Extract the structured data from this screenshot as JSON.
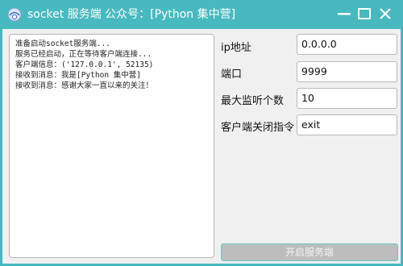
{
  "window": {
    "title": "socket 服务端   公众号：[Python 集中营]",
    "accent_color": "#48b9bf",
    "controls": [
      "minimize-icon",
      "maximize-icon",
      "close-icon"
    ]
  },
  "log": {
    "lines": [
      "准备启动socket服务端...",
      "服务已经启动，正在等待客户端连接...",
      "客户端信息：('127.0.0.1', 52135)",
      "接收到消息：我是[Python 集中营]",
      "接收到消息：感谢大家一直以来的关注！"
    ]
  },
  "form": {
    "ip_label": "ip地址",
    "ip_value": "0.0.0.0",
    "port_label": "端口",
    "port_value": "9999",
    "max_listen_label": "最大监听个数",
    "max_listen_value": "10",
    "close_cmd_label": "客户端关闭指令",
    "close_cmd_value": "exit"
  },
  "buttons": {
    "start_label": "开启服务端",
    "start_enabled": false
  }
}
